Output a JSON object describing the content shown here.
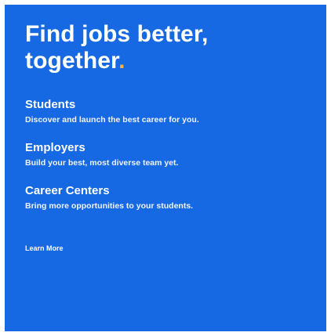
{
  "colors": {
    "panel_background": "#1769e3",
    "text": "#ffffff",
    "accent": "#f5b53a"
  },
  "hero": {
    "headline_line1": "Find jobs better,",
    "headline_line2": "together",
    "headline_punct": "."
  },
  "sections": [
    {
      "title": "Students",
      "description": "Discover and launch the best career for you."
    },
    {
      "title": "Employers",
      "description": "Build your best, most diverse team yet."
    },
    {
      "title": "Career Centers",
      "description": "Bring more opportunities to your students."
    }
  ],
  "cta": {
    "learn_more_label": "Learn More"
  }
}
